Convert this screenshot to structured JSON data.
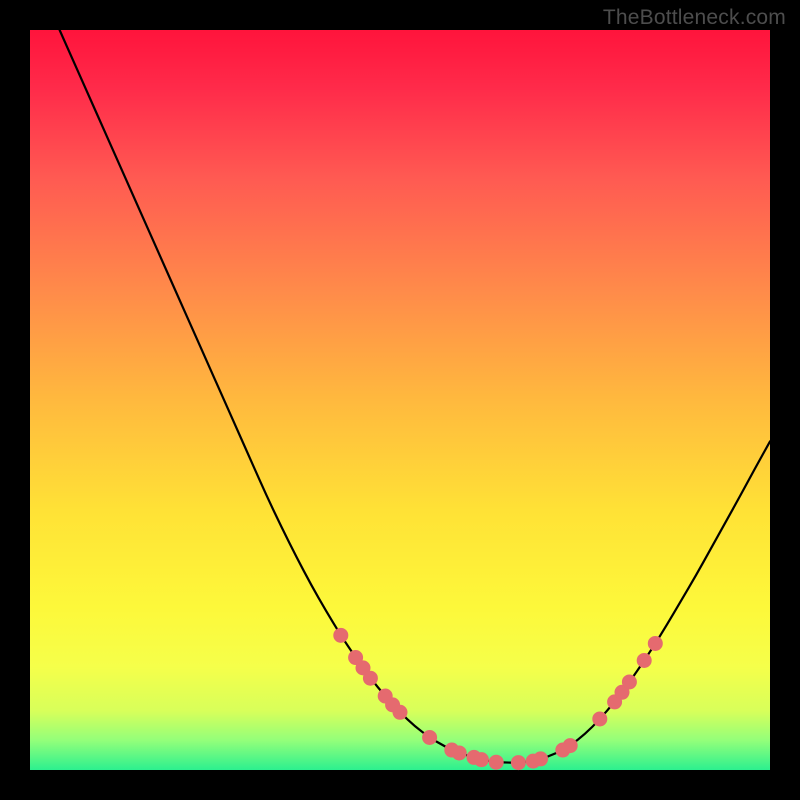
{
  "watermark": "TheBottleneck.com",
  "colors": {
    "background_border": "#000000",
    "watermark_text": "#4d4d4d",
    "curve": "#000000",
    "marker": "#e56a6f",
    "gradient_top": "#ff143c",
    "gradient_bottom": "#2cf08f"
  },
  "chart_data": {
    "type": "line",
    "title": "",
    "xlabel": "",
    "ylabel": "",
    "xlim": [
      0,
      100
    ],
    "ylim": [
      0,
      100
    ],
    "grid": false,
    "legend": null,
    "series": [
      {
        "name": "bottleneck-curve",
        "x": [
          4,
          6,
          8,
          10,
          12,
          14,
          16,
          18,
          20,
          22,
          24,
          26,
          28,
          30,
          32,
          34,
          36,
          38,
          40,
          42,
          44,
          46,
          48,
          50,
          52,
          54,
          56,
          58,
          60,
          62,
          64,
          66,
          68,
          70,
          72,
          74,
          76,
          78,
          80,
          82,
          84,
          86,
          88,
          90,
          92,
          94,
          96,
          98,
          100
        ],
        "y": [
          100,
          95.5,
          91,
          86.5,
          82,
          77.5,
          73,
          68.5,
          64,
          59.5,
          55,
          50.5,
          46,
          41.5,
          37,
          32.8,
          28.8,
          25,
          21.5,
          18.2,
          15.2,
          12.4,
          10,
          7.8,
          5.9,
          4.4,
          3.2,
          2.3,
          1.7,
          1.2,
          1,
          1,
          1.2,
          1.8,
          2.7,
          4,
          5.8,
          8,
          10.5,
          13.3,
          16.3,
          19.5,
          22.9,
          26.3,
          29.9,
          33.5,
          37.1,
          40.8,
          44.4
        ]
      }
    ],
    "markers": [
      {
        "series": "bottleneck-curve",
        "x": 42,
        "y": 18.2
      },
      {
        "series": "bottleneck-curve",
        "x": 44,
        "y": 15.2
      },
      {
        "series": "bottleneck-curve",
        "x": 45,
        "y": 13.8
      },
      {
        "series": "bottleneck-curve",
        "x": 46,
        "y": 12.4
      },
      {
        "series": "bottleneck-curve",
        "x": 48,
        "y": 10
      },
      {
        "series": "bottleneck-curve",
        "x": 49,
        "y": 8.8
      },
      {
        "series": "bottleneck-curve",
        "x": 50,
        "y": 7.8
      },
      {
        "series": "bottleneck-curve",
        "x": 54,
        "y": 4.4
      },
      {
        "series": "bottleneck-curve",
        "x": 57,
        "y": 2.7
      },
      {
        "series": "bottleneck-curve",
        "x": 58,
        "y": 2.3
      },
      {
        "series": "bottleneck-curve",
        "x": 60,
        "y": 1.7
      },
      {
        "series": "bottleneck-curve",
        "x": 61,
        "y": 1.4
      },
      {
        "series": "bottleneck-curve",
        "x": 63,
        "y": 1.05
      },
      {
        "series": "bottleneck-curve",
        "x": 66,
        "y": 1
      },
      {
        "series": "bottleneck-curve",
        "x": 68,
        "y": 1.2
      },
      {
        "series": "bottleneck-curve",
        "x": 69,
        "y": 1.5
      },
      {
        "series": "bottleneck-curve",
        "x": 72,
        "y": 2.7
      },
      {
        "series": "bottleneck-curve",
        "x": 73,
        "y": 3.3
      },
      {
        "series": "bottleneck-curve",
        "x": 77,
        "y": 6.9
      },
      {
        "series": "bottleneck-curve",
        "x": 79,
        "y": 9.2
      },
      {
        "series": "bottleneck-curve",
        "x": 80,
        "y": 10.5
      },
      {
        "series": "bottleneck-curve",
        "x": 81,
        "y": 11.9
      },
      {
        "series": "bottleneck-curve",
        "x": 83,
        "y": 14.8
      },
      {
        "series": "bottleneck-curve",
        "x": 84.5,
        "y": 17.1
      }
    ],
    "marker_radius": 7
  }
}
